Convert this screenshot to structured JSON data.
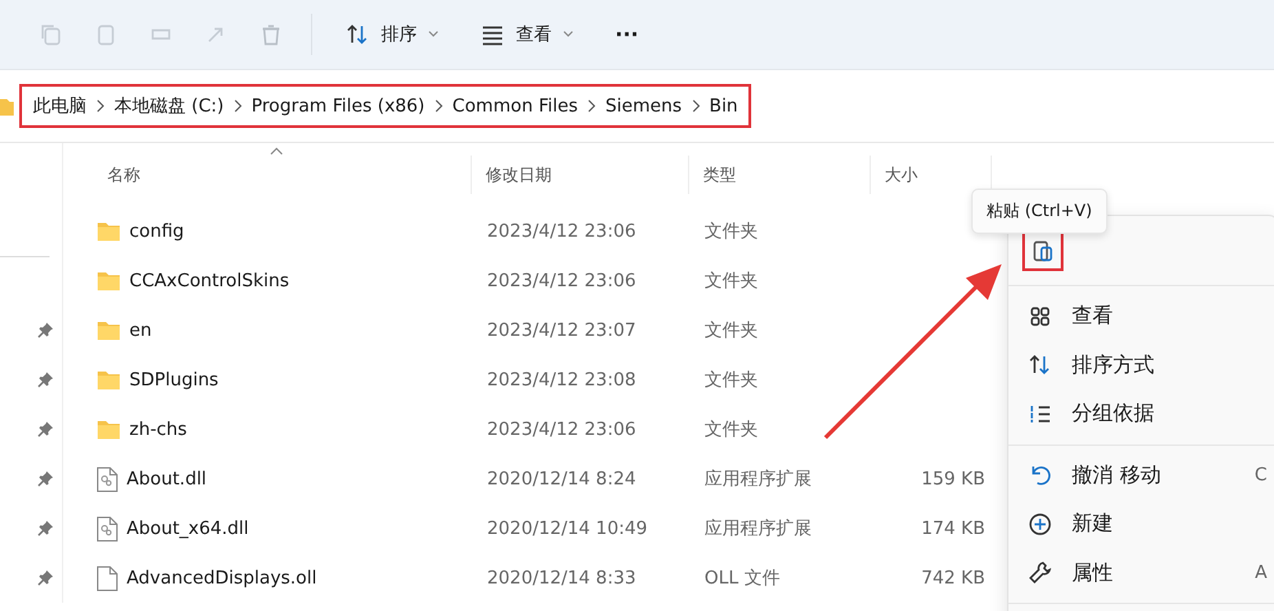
{
  "toolbar": {
    "buttons": [
      {
        "kind": "sort",
        "label": "排序"
      },
      {
        "kind": "view",
        "label": "查看"
      },
      {
        "kind": "more",
        "label": "···"
      }
    ]
  },
  "breadcrumb": {
    "items": [
      "此电脑",
      "本地磁盘 (C:)",
      "Program Files (x86)",
      "Common Files",
      "Siemens",
      "Bin"
    ],
    "highlighted": true
  },
  "columns": [
    "名称",
    "修改日期",
    "类型",
    "大小"
  ],
  "rows": [
    {
      "kind": "folder",
      "name": "config",
      "date": "2023/4/12 23:06",
      "type": "文件夹",
      "pinned": false
    },
    {
      "kind": "folder",
      "name": "CCAxControlSkins",
      "date": "2023/4/12 23:06",
      "type": "文件夹",
      "pinned": false
    },
    {
      "kind": "folder",
      "name": "en",
      "date": "2023/4/12 23:07",
      "type": "文件夹",
      "pinned": true
    },
    {
      "kind": "folder",
      "name": "SDPlugins",
      "date": "2023/4/12 23:08",
      "type": "文件夹",
      "pinned": true
    },
    {
      "kind": "folder",
      "name": "zh-chs",
      "date": "2023/4/12 23:06",
      "type": "文件夹",
      "pinned": true
    },
    {
      "kind": "dll",
      "name": "About.dll",
      "date": "2020/12/14 8:24",
      "type": "应用程序扩展",
      "size": "159 KB",
      "pinned": true
    },
    {
      "kind": "dll",
      "name": "About_x64.dll",
      "date": "2020/12/14 10:49",
      "type": "应用程序扩展",
      "size": "174 KB",
      "pinned": true
    },
    {
      "kind": "file",
      "name": "AdvancedDisplays.oll",
      "date": "2020/12/14 8:33",
      "type": "OLL 文件",
      "size": "742 KB",
      "pinned": true
    }
  ],
  "context_menu": {
    "tooltip": "粘贴 (Ctrl+V)",
    "paste_highlighted": true,
    "groups": [
      [
        {
          "kind": "view",
          "label": "查看"
        },
        {
          "kind": "sort",
          "label": "排序方式"
        },
        {
          "kind": "group",
          "label": "分组依据"
        }
      ],
      [
        {
          "kind": "undo",
          "label": "撤消 移动",
          "shortcut": "C"
        },
        {
          "kind": "new",
          "label": "新建"
        },
        {
          "kind": "properties",
          "label": "属性",
          "shortcut": "A"
        }
      ]
    ]
  }
}
